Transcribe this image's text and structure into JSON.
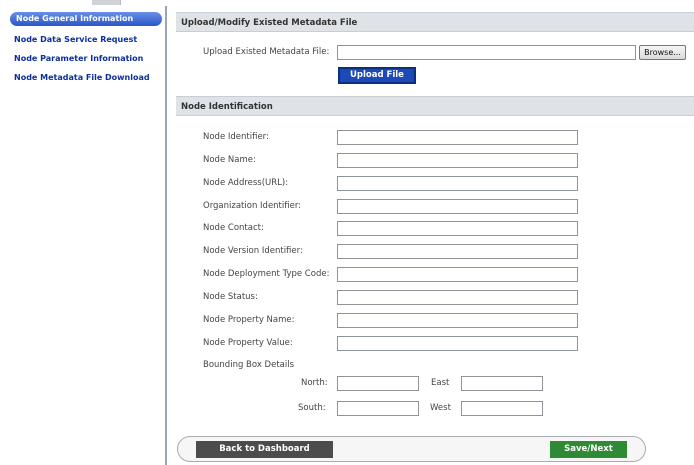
{
  "sidebar": {
    "items": [
      {
        "label": "Node General Information"
      },
      {
        "label": "Node Data Service Request"
      },
      {
        "label": "Node Parameter Information"
      },
      {
        "label": "Node Metadata File Download"
      }
    ]
  },
  "upload_section": {
    "header": "Upload/Modify Existed Metadata File",
    "file_label": "Upload Existed Metadata File:",
    "file_value": "",
    "browse_label": "Browse...",
    "upload_button": "Upload File"
  },
  "identification_section": {
    "header": "Node Identification",
    "fields": [
      {
        "label": "Node Identifier:",
        "value": ""
      },
      {
        "label": "Node Name:",
        "value": ""
      },
      {
        "label": "Node Address(URL):",
        "value": ""
      },
      {
        "label": "Organization Identifier:",
        "value": ""
      },
      {
        "label": "Node Contact:",
        "value": ""
      },
      {
        "label": "Node Version Identifier:",
        "value": ""
      },
      {
        "label": "Node Deployment Type Code:",
        "value": ""
      },
      {
        "label": "Node Status:",
        "value": ""
      },
      {
        "label": "Node Property Name:",
        "value": ""
      },
      {
        "label": "Node Property Value:",
        "value": ""
      }
    ],
    "bounding_box": {
      "title": "Bounding Box Details",
      "north_label": "North:",
      "north_value": "",
      "east_label": "East",
      "east_value": "",
      "south_label": "South:",
      "south_value": "",
      "west_label": "West",
      "west_value": ""
    }
  },
  "footer": {
    "back_button": "Back to Dashboard",
    "save_button": "Save/Next"
  }
}
